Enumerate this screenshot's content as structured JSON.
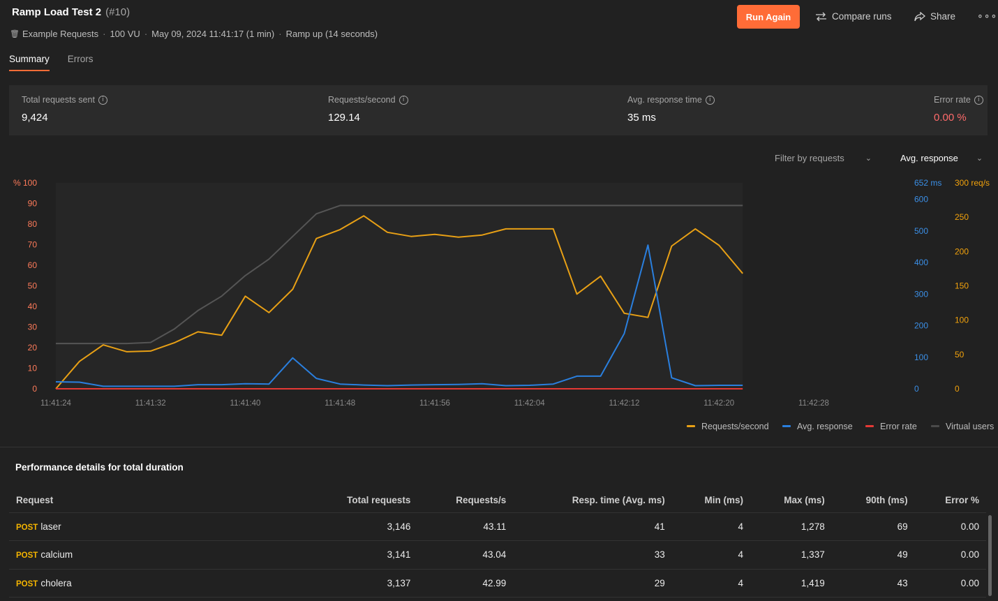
{
  "header": {
    "title": "Ramp Load Test 2",
    "run_number": "(#10)",
    "collection": "Example Requests",
    "vus": "100 VU",
    "datetime": "May 09, 2024 11:41:17 (1 min)",
    "ramp": "Ramp up (14 seconds)",
    "run_again": "Run Again",
    "compare_runs": "Compare runs",
    "share": "Share"
  },
  "tabs": [
    {
      "label": "Summary"
    },
    {
      "label": "Errors"
    }
  ],
  "stats": [
    {
      "label": "Total requests sent",
      "value": "9,424"
    },
    {
      "label": "Requests/second",
      "value": "129.14"
    },
    {
      "label": "Avg. response time",
      "value": "35 ms"
    },
    {
      "label": "Error rate",
      "value": "0.00 %"
    }
  ],
  "filters": {
    "filter_by": "Filter by requests",
    "metric": "Avg. response"
  },
  "chart_data": {
    "type": "line",
    "x_ticks": [
      "11:41:24",
      "11:41:32",
      "11:41:40",
      "11:41:48",
      "11:41:56",
      "11:42:04",
      "11:42:12",
      "11:42:20",
      "11:42:28"
    ],
    "x_seconds": [
      8,
      10,
      12,
      14,
      16,
      18,
      20,
      22,
      24,
      26,
      28,
      30,
      32,
      34,
      36,
      38,
      40,
      42,
      44,
      46,
      48,
      50,
      52,
      54,
      56,
      58,
      60,
      62,
      64,
      66
    ],
    "left_axis": {
      "label": "%",
      "ticks": [
        0,
        10,
        20,
        30,
        40,
        50,
        60,
        70,
        80,
        90,
        100
      ],
      "color": "#ff7b5a"
    },
    "right_axis_ms": {
      "top_label": "652 ms",
      "ticks": [
        0,
        100,
        200,
        300,
        400,
        500,
        600
      ],
      "max": 652,
      "color": "#3b8fe6"
    },
    "right_axis_rps": {
      "top_label": "300 req/s",
      "ticks": [
        0,
        50,
        100,
        150,
        200,
        250
      ],
      "max": 300,
      "color": "#f2a20c"
    },
    "series": [
      {
        "name": "Requests/second",
        "color": "#e8a015",
        "axis": "rps",
        "values": [
          0,
          40,
          64,
          54,
          55,
          67,
          83,
          78,
          135,
          111,
          145,
          219,
          232,
          252,
          228,
          222,
          225,
          221,
          224,
          233,
          233,
          233,
          138,
          164,
          110,
          104,
          208,
          233,
          209,
          168
        ]
      },
      {
        "name": "Avg. response",
        "color": "#2a7fde",
        "axis": "ms",
        "values": [
          22,
          21,
          8,
          8,
          8,
          8,
          13,
          13,
          16,
          15,
          98,
          33,
          15,
          12,
          10,
          12,
          13,
          14,
          16,
          10,
          11,
          15,
          40,
          40,
          175,
          455,
          35,
          10,
          11,
          11
        ]
      },
      {
        "name": "Error rate",
        "color": "#e53935",
        "axis": "pct",
        "values": [
          0,
          0,
          0,
          0,
          0,
          0,
          0,
          0,
          0,
          0,
          0,
          0,
          0,
          0,
          0,
          0,
          0,
          0,
          0,
          0,
          0,
          0,
          0,
          0,
          0,
          0,
          0,
          0,
          0,
          0
        ]
      },
      {
        "name": "Virtual users",
        "color": "#555555",
        "axis": "pct",
        "values": [
          22,
          22,
          22,
          22,
          22.5,
          29,
          38,
          45,
          55,
          63,
          74,
          85,
          89,
          89,
          89,
          89,
          89,
          89,
          89,
          89,
          89,
          89,
          89,
          89,
          89,
          89,
          89,
          89,
          89,
          89
        ]
      }
    ]
  },
  "table": {
    "title": "Performance details for total duration",
    "columns": [
      "Request",
      "Total requests",
      "Requests/s",
      "Resp. time (Avg. ms)",
      "Min (ms)",
      "Max (ms)",
      "90th (ms)",
      "Error %"
    ],
    "rows": [
      {
        "method": "POST",
        "name": "laser",
        "total": "3,146",
        "rps": "43.11",
        "avg": "41",
        "min": "4",
        "max": "1,278",
        "p90": "69",
        "err": "0.00"
      },
      {
        "method": "POST",
        "name": "calcium",
        "total": "3,141",
        "rps": "43.04",
        "avg": "33",
        "min": "4",
        "max": "1,337",
        "p90": "49",
        "err": "0.00"
      },
      {
        "method": "POST",
        "name": "cholera",
        "total": "3,137",
        "rps": "42.99",
        "avg": "29",
        "min": "4",
        "max": "1,419",
        "p90": "43",
        "err": "0.00"
      }
    ]
  }
}
